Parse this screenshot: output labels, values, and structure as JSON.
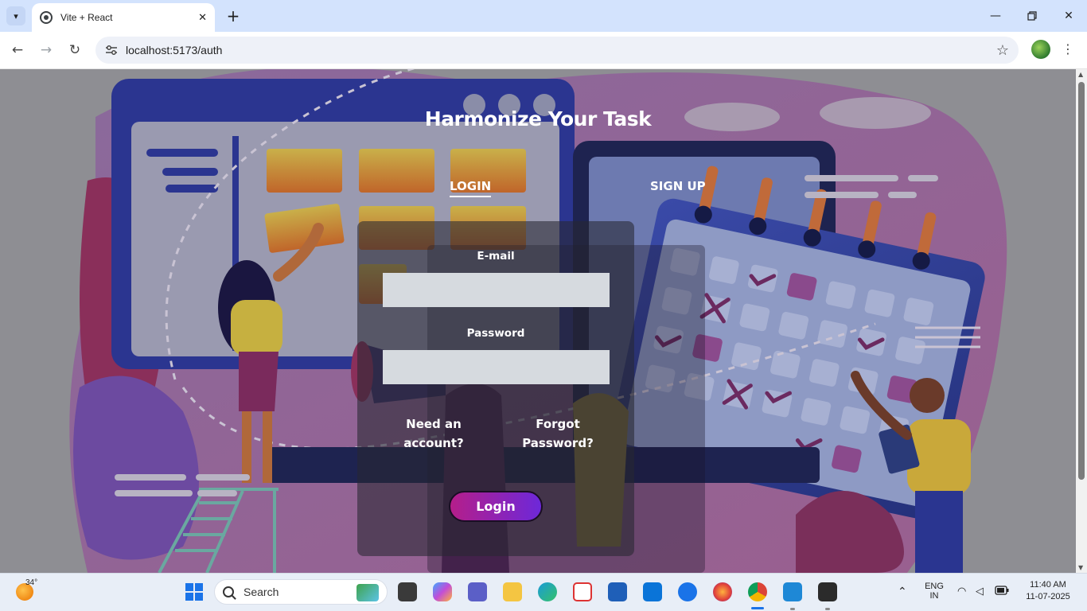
{
  "browser": {
    "tab_title": "Vite + React",
    "url": "localhost:5173/auth"
  },
  "page": {
    "title": "Harmonize Your Task",
    "tabs": [
      {
        "label": "LOGIN",
        "active": true
      },
      {
        "label": "SIGN UP",
        "active": false
      }
    ],
    "email_label": "E-mail",
    "email_value": "",
    "password_label": "Password",
    "password_value": "",
    "need_account_line1": "Need an",
    "need_account_line2": "account?",
    "forgot_line1": "Forgot",
    "forgot_line2": "Password?",
    "login_button": "Login",
    "button_gradient": [
      "#b51e8a",
      "#6d28d9"
    ]
  },
  "taskbar": {
    "weather_temp": "34°",
    "search_placeholder": "Search",
    "language_line1": "ENG",
    "language_line2": "IN",
    "time": "11:40 AM",
    "date": "11-07-2025"
  }
}
